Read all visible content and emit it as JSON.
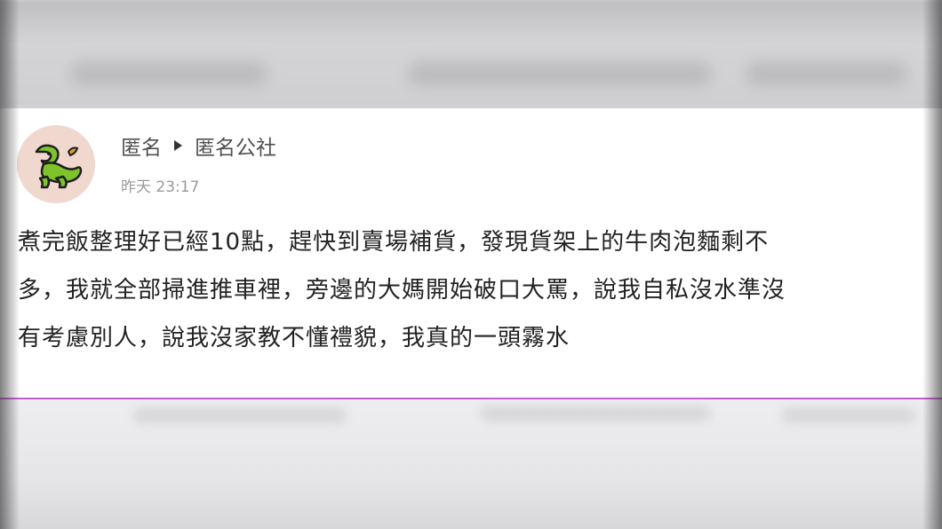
{
  "post": {
    "author": "匿名",
    "board": "匿名公社",
    "timestamp": "昨天 23:17",
    "lines": [
      "煮完飯整理好已經10點，趕快到賣場補貨，發現貨架上的牛肉泡麵剩不",
      "多，我就全部掃進推車裡，旁邊的大媽開始破口大罵，說我自私沒水準沒",
      "有考慮別人，說我沒家教不懂禮貌，我真的一頭霧水"
    ]
  },
  "avatar": {
    "icon": "dragon-icon",
    "bg_color": "#f0d8cf",
    "icon_color": "#7dc42a"
  },
  "colors": {
    "divider": "#c45bd0",
    "text": "#222222",
    "meta": "#505050",
    "timestamp": "#9a9a9a"
  }
}
